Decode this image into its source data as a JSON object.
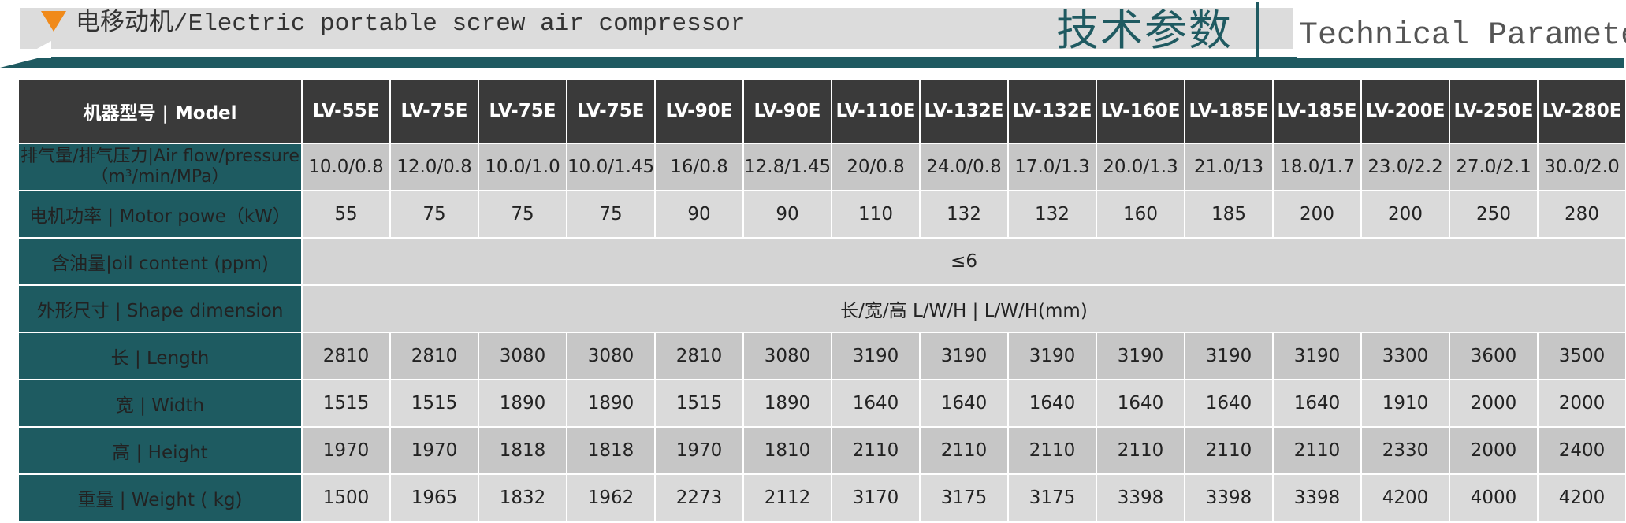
{
  "header": {
    "title": "电移动机/Electric portable screw air compressor",
    "cn_title": "技术参数",
    "en_title": "Technical Parameters"
  },
  "colors": {
    "accent_teal": "#1e5b61",
    "header_dark": "#3a3a3a",
    "orange": "#f08a1a"
  },
  "table": {
    "model_label": "机器型号 | Model",
    "models": [
      "LV-55E",
      "LV-75E",
      "LV-75E",
      "LV-75E",
      "LV-90E",
      "LV-90E",
      "LV-110E",
      "LV-132E",
      "LV-132E",
      "LV-160E",
      "LV-185E",
      "LV-185E",
      "LV-200E",
      "LV-250E",
      "LV-280E"
    ],
    "rows": {
      "airflow": {
        "label_line1": "排气量/排气压力|Air flow/pressure",
        "label_line2": "（m³/min/MPa）",
        "values": [
          "10.0/0.8",
          "12.0/0.8",
          "10.0/1.0",
          "10.0/1.45",
          "16/0.8",
          "12.8/1.45",
          "20/0.8",
          "24.0/0.8",
          "17.0/1.3",
          "20.0/1.3",
          "21.0/13",
          "18.0/1.7",
          "23.0/2.2",
          "27.0/2.1",
          "30.0/2.0"
        ]
      },
      "motor": {
        "label": "电机功率 | Motor powe（kW）",
        "values": [
          "55",
          "75",
          "75",
          "75",
          "90",
          "90",
          "110",
          "132",
          "132",
          "160",
          "185",
          "200",
          "200",
          "250",
          "280"
        ]
      },
      "oil": {
        "label": "含油量|oil content (ppm)",
        "value": "≤6"
      },
      "shape": {
        "label": "外形尺寸 | Shape dimension",
        "value": "长/宽/高  L/W/H  |   L/W/H(mm)"
      },
      "length": {
        "label": "长 | Length",
        "values": [
          "2810",
          "2810",
          "3080",
          "3080",
          "2810",
          "3080",
          "3190",
          "3190",
          "3190",
          "3190",
          "3190",
          "3190",
          "3300",
          "3600",
          "3500"
        ]
      },
      "width": {
        "label": "宽 | Width",
        "values": [
          "1515",
          "1515",
          "1890",
          "1890",
          "1515",
          "1890",
          "1640",
          "1640",
          "1640",
          "1640",
          "1640",
          "1640",
          "1910",
          "2000",
          "2000"
        ]
      },
      "height": {
        "label": "高 | Height",
        "values": [
          "1970",
          "1970",
          "1818",
          "1818",
          "1970",
          "1810",
          "2110",
          "2110",
          "2110",
          "2110",
          "2110",
          "2110",
          "2330",
          "2000",
          "2400"
        ]
      },
      "weight": {
        "label": "重量 | Weight ( kg)",
        "values": [
          "1500",
          "1965",
          "1832",
          "1962",
          "2273",
          "2112",
          "3170",
          "3175",
          "3175",
          "3398",
          "3398",
          "3398",
          "4200",
          "4000",
          "4200"
        ]
      }
    }
  }
}
